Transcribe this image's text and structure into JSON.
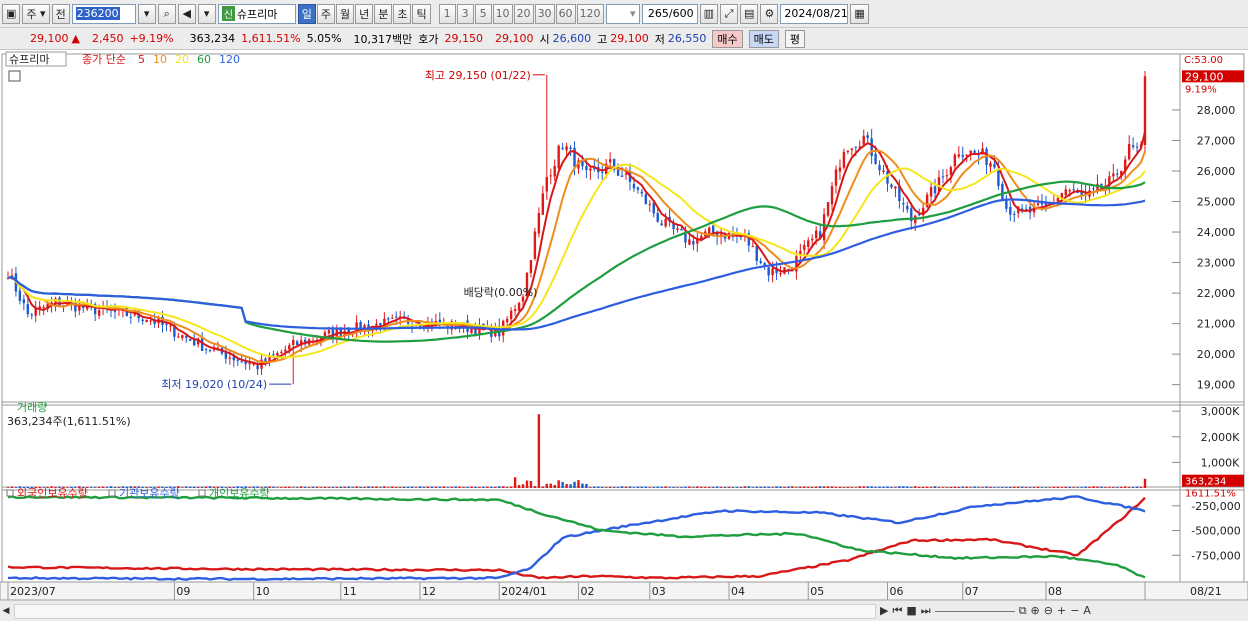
{
  "toolbar": {
    "market": "주",
    "market_alt": "전",
    "code": "236200",
    "stock_tag": "신",
    "stock_name": "슈프리마",
    "periods": [
      "일",
      "주",
      "월",
      "년",
      "분",
      "초",
      "틱"
    ],
    "active_period": "일",
    "intervals": [
      "1",
      "3",
      "5",
      "10",
      "20",
      "30",
      "60",
      "120"
    ],
    "count": "265",
    "count_total": "/600",
    "date": "2024/08/21"
  },
  "quote": {
    "price": "29,100",
    "change_arrow": "▲",
    "change": "2,450",
    "change_pct": "+9.19%",
    "volume": "363,234",
    "volume_ratio": "1,611.51%",
    "turnover_pct": "5.05%",
    "amount": "10,317백만",
    "bid_label": "호가",
    "bid1": "29,150",
    "bid2": "29,100",
    "open_label": "시",
    "open": "26,600",
    "high_label": "고",
    "high": "29,100",
    "low_label": "저",
    "low": "26,550",
    "buy": "매수",
    "sell": "매도",
    "flat": "평"
  },
  "price_panel": {
    "stock_name": "슈프리마",
    "legend_lead": "종가 단순",
    "ma_labels": [
      "5",
      "10",
      "20",
      "60",
      "120"
    ],
    "ma_colors": [
      "#d81818",
      "#f08c1c",
      "#f5e61c",
      "#1e9e3e",
      "#2e5ee0"
    ],
    "high_annotation": "최고 29,150 (01/22)",
    "low_annotation": "최저 19,020 (10/24)",
    "dividend_annotation": "배당락(0.00%)",
    "axis_top": "C:53.00",
    "last_price": "29,100",
    "last_pct": "9.19%"
  },
  "volume_panel": {
    "title": "거래량",
    "value": "363,234주(1,611.51%)",
    "last": "363,234",
    "last_pct": "1611.51%"
  },
  "holdings_panel": {
    "series_labels": [
      "외국인보유수량",
      "기관보유수량",
      "개인보유수량"
    ]
  },
  "chart_data": [
    {
      "type": "candlestick",
      "y_ticks": [
        19000,
        20000,
        21000,
        22000,
        23000,
        24000,
        25000,
        26000,
        27000,
        28000
      ],
      "ylim": [
        18400,
        29700
      ],
      "x_labels": [
        "2023/07",
        "09",
        "10",
        "11",
        "12",
        "2024/01",
        "02",
        "03",
        "04",
        "05",
        "06",
        "07",
        "08",
        "08/21"
      ],
      "close_keyframes": [
        [
          0,
          22700
        ],
        [
          5,
          21300
        ],
        [
          12,
          21700
        ],
        [
          20,
          21500
        ],
        [
          35,
          21200
        ],
        [
          50,
          20200
        ],
        [
          63,
          19600
        ],
        [
          72,
          20300
        ],
        [
          85,
          20800
        ],
        [
          100,
          21100
        ],
        [
          115,
          20900
        ],
        [
          124,
          20700
        ],
        [
          130,
          22000
        ],
        [
          136,
          25800
        ],
        [
          140,
          26900
        ],
        [
          146,
          25800
        ],
        [
          152,
          26200
        ],
        [
          158,
          25500
        ],
        [
          165,
          24300
        ],
        [
          172,
          23700
        ],
        [
          178,
          24000
        ],
        [
          186,
          23800
        ],
        [
          192,
          22700
        ],
        [
          197,
          22800
        ],
        [
          205,
          24000
        ],
        [
          211,
          26800
        ],
        [
          216,
          27100
        ],
        [
          222,
          25700
        ],
        [
          228,
          24400
        ],
        [
          235,
          25600
        ],
        [
          240,
          26700
        ],
        [
          246,
          26500
        ],
        [
          249,
          26200
        ],
        [
          252,
          24800
        ],
        [
          256,
          24600
        ],
        [
          262,
          24800
        ],
        [
          267,
          25400
        ],
        [
          272,
          25100
        ],
        [
          279,
          25700
        ],
        [
          283,
          26700
        ],
        [
          286,
          26650
        ],
        [
          287,
          29100
        ]
      ],
      "ma_series": [
        "MA5",
        "MA10",
        "MA20",
        "MA60",
        "MA120"
      ],
      "last_close": 29100,
      "high": {
        "value": 29150,
        "date": "01/22"
      },
      "low": {
        "value": 19020,
        "date": "10/24"
      }
    },
    {
      "type": "bar",
      "name": "거래량",
      "y_ticks": [
        "1,000K",
        "2,000K",
        "3,000K"
      ],
      "ylim": [
        0,
        3200000
      ],
      "peak": 2880000,
      "last": 363234
    },
    {
      "type": "line",
      "y_ticks": [
        "-750,000",
        "-500,000",
        "-250,000"
      ],
      "ylim": [
        -1000000,
        -100000
      ],
      "series": [
        {
          "name": "외국인보유수량",
          "color": "#d81818",
          "keyframes": [
            [
              0,
              -870000
            ],
            [
              60,
              -890000
            ],
            [
              124,
              -900000
            ],
            [
              134,
              -980000
            ],
            [
              148,
              -960000
            ],
            [
              165,
              -980000
            ],
            [
              190,
              -960000
            ],
            [
              212,
              -800000
            ],
            [
              228,
              -600000
            ],
            [
              248,
              -590000
            ],
            [
              270,
              -750000
            ],
            [
              282,
              -350000
            ],
            [
              287,
              -170000
            ]
          ]
        },
        {
          "name": "기관보유수량",
          "color": "#2e5ee0",
          "keyframes": [
            [
              0,
              -980000
            ],
            [
              60,
              -990000
            ],
            [
              124,
              -980000
            ],
            [
              132,
              -880000
            ],
            [
              140,
              -570000
            ],
            [
              158,
              -440000
            ],
            [
              180,
              -300000
            ],
            [
              205,
              -320000
            ],
            [
              225,
              -420000
            ],
            [
              245,
              -250000
            ],
            [
              270,
              -160000
            ],
            [
              287,
              -300000
            ]
          ]
        },
        {
          "name": "개인보유수량",
          "color": "#1e9e3e",
          "keyframes": [
            [
              0,
              -160000
            ],
            [
              60,
              -170000
            ],
            [
              124,
              -190000
            ],
            [
              135,
              -330000
            ],
            [
              150,
              -500000
            ],
            [
              170,
              -560000
            ],
            [
              200,
              -530000
            ],
            [
              215,
              -700000
            ],
            [
              240,
              -780000
            ],
            [
              265,
              -760000
            ],
            [
              280,
              -850000
            ],
            [
              287,
              -980000
            ]
          ]
        }
      ]
    }
  ]
}
